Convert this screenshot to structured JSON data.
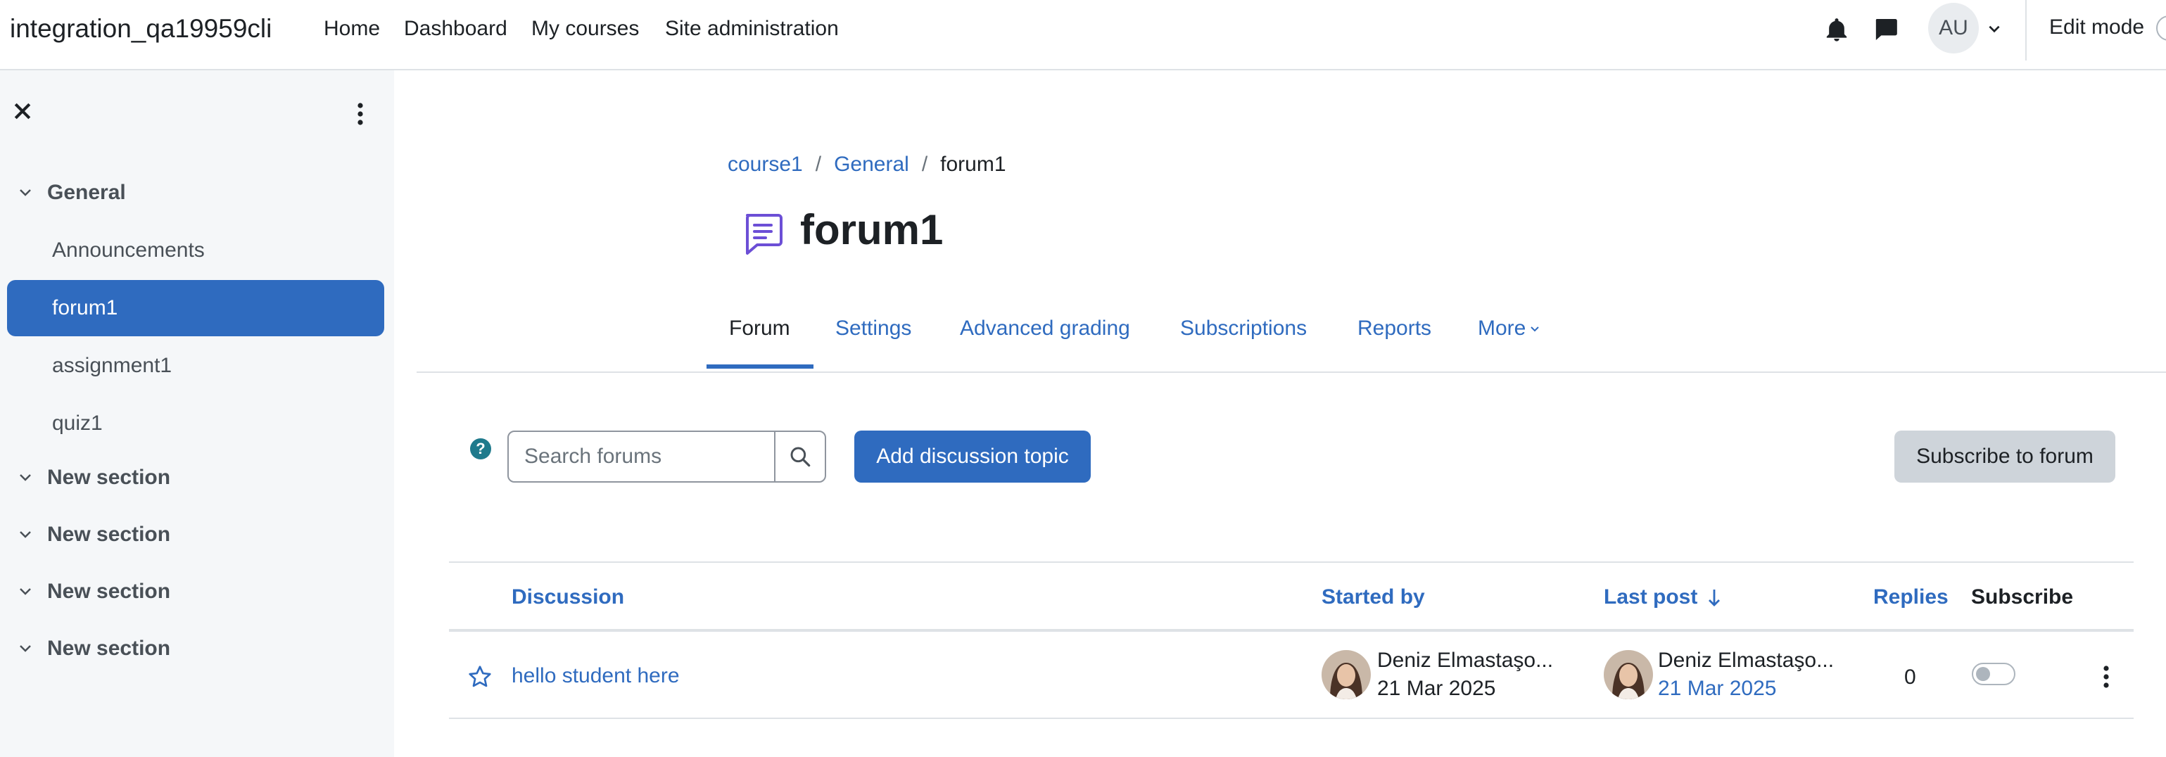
{
  "navbar": {
    "site_name": "integration_qa19959cli",
    "links": [
      "Home",
      "Dashboard",
      "My courses",
      "Site administration"
    ],
    "icons": [
      "bell-icon",
      "chat-icon"
    ],
    "user_initials": "AU",
    "edit_mode_label": "Edit mode"
  },
  "drawer": {
    "sections": [
      {
        "label": "General",
        "items": [
          "Announcements",
          "forum1",
          "assignment1",
          "quiz1"
        ]
      },
      {
        "label": "New section"
      },
      {
        "label": "New section"
      },
      {
        "label": "New section"
      },
      {
        "label": "New section"
      }
    ],
    "active_item": "forum1"
  },
  "breadcrumb": {
    "items": [
      "course1",
      "General",
      "forum1"
    ]
  },
  "page": {
    "title": "forum1"
  },
  "tabs": {
    "items": [
      "Forum",
      "Settings",
      "Advanced grading",
      "Subscriptions",
      "Reports",
      "More"
    ],
    "active": "Forum"
  },
  "toolbar": {
    "help": "?",
    "search_placeholder": "Search forums",
    "add_label": "Add discussion topic",
    "subscribe_label": "Subscribe to forum"
  },
  "table": {
    "headers": {
      "discussion": "Discussion",
      "started_by": "Started by",
      "last_post": "Last post",
      "replies": "Replies",
      "subscribe": "Subscribe"
    },
    "rows": [
      {
        "discussion": "hello student here",
        "started_by_name": "Deniz Elmastaşo...",
        "started_by_date": "21 Mar 2025",
        "last_post_name": "Deniz Elmastaşo...",
        "last_post_date": "21 Mar 2025",
        "replies": "0",
        "subscribed": false
      }
    ]
  },
  "colors": {
    "primary": "#2f6bbf",
    "drawer_bg": "#f5f7f9",
    "forum_icon": "#6c4fd6",
    "help": "#1f7a8c"
  }
}
